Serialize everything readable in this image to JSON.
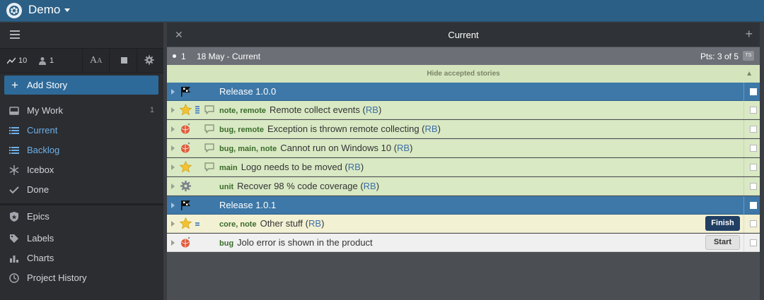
{
  "app": {
    "project_title": "Demo",
    "colors": {
      "topbar": "#2c5f86",
      "accent": "#2e6a99",
      "release": "#3d78a8",
      "accepted": "#d9e9c4"
    }
  },
  "sidebar": {
    "stats": {
      "velocity": "10",
      "members": "1"
    },
    "font_toggle": "AA",
    "add_story": "Add Story",
    "items": [
      {
        "label": "My Work",
        "icon": "inbox-icon",
        "count": "1"
      },
      {
        "label": "Current",
        "icon": "list-icon",
        "active": true
      },
      {
        "label": "Backlog",
        "icon": "list-icon",
        "active": true
      },
      {
        "label": "Icebox",
        "icon": "snowflake-icon"
      },
      {
        "label": "Done",
        "icon": "check-icon"
      },
      {
        "label": "Epics",
        "icon": "shield-icon"
      },
      {
        "label": "Labels",
        "icon": "tag-icon"
      },
      {
        "label": "Charts",
        "icon": "bar-chart-icon"
      },
      {
        "label": "Project History",
        "icon": "clock-icon"
      }
    ]
  },
  "panel": {
    "title": "Current",
    "iteration": {
      "number": "1",
      "date": "18 May - Current",
      "points": "Pts: 3 of 5",
      "ts_label": "TS"
    },
    "hide_accepted": "Hide accepted stories",
    "rows": [
      {
        "kind": "release",
        "text": "Release 1.0.0"
      },
      {
        "kind": "feature",
        "state": "accepted",
        "labels": "note, remote",
        "title": "Remote collect events",
        "owner": "RB"
      },
      {
        "kind": "bug",
        "state": "accepted",
        "labels": "bug, remote",
        "title": "Exception is thrown remote collecting",
        "owner": "RB"
      },
      {
        "kind": "bug",
        "state": "accepted",
        "labels": "bug, main, note",
        "title": "Cannot run on Windows 10",
        "owner": "RB"
      },
      {
        "kind": "feature",
        "state": "accepted",
        "labels": "main",
        "title": "Logo needs to be moved",
        "owner": "RB"
      },
      {
        "kind": "chore",
        "state": "accepted",
        "labels": "unit",
        "title": "Recover 98 % code coverage",
        "owner": "RB"
      },
      {
        "kind": "release",
        "text": "Release 1.0.1"
      },
      {
        "kind": "feature",
        "state": "started",
        "labels": "core, note",
        "title": "Other stuff",
        "owner": "RB",
        "button": "Finish"
      },
      {
        "kind": "bug",
        "state": "unstarted",
        "labels": "bug",
        "title": "Jolo error is shown in the product",
        "button": "Start"
      }
    ]
  }
}
